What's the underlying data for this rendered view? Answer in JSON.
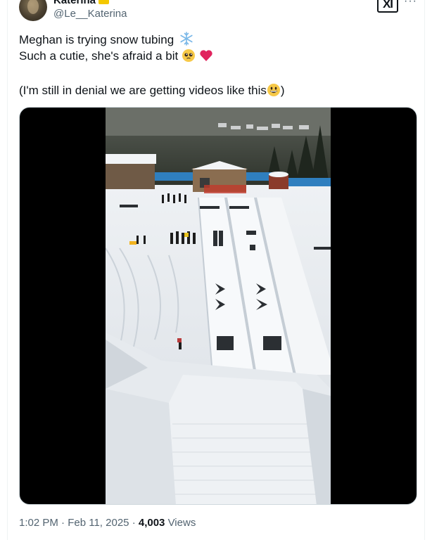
{
  "author": {
    "display_name": "Katerina",
    "handle": "@Le__Katerina"
  },
  "header": {
    "logo_label": "XI"
  },
  "tweet": {
    "line1": "Meghan is trying snow tubing",
    "line2": "Such a cutie, she's afraid a bit",
    "line3_open": "(I'm still in denial we are getting videos like this",
    "line3_close": ")"
  },
  "footer": {
    "time": "1:02 PM",
    "sep1": "·",
    "date": "Feb 11, 2025",
    "sep2": "·",
    "views_count": "4,003",
    "views_label": "Views"
  },
  "icons": {
    "verified": "verified-badge",
    "more": "more-dots",
    "snowflake": "snowflake-emoji",
    "pleading_face": "pleading-face-emoji",
    "heart": "red-heart-emoji",
    "grinning_face": "grinning-face-emoji"
  },
  "colors": {
    "text": "#0f1419",
    "secondary": "#536471",
    "badge": "#f4c800",
    "heart": "#e0245e",
    "media_bg": "#000000"
  }
}
